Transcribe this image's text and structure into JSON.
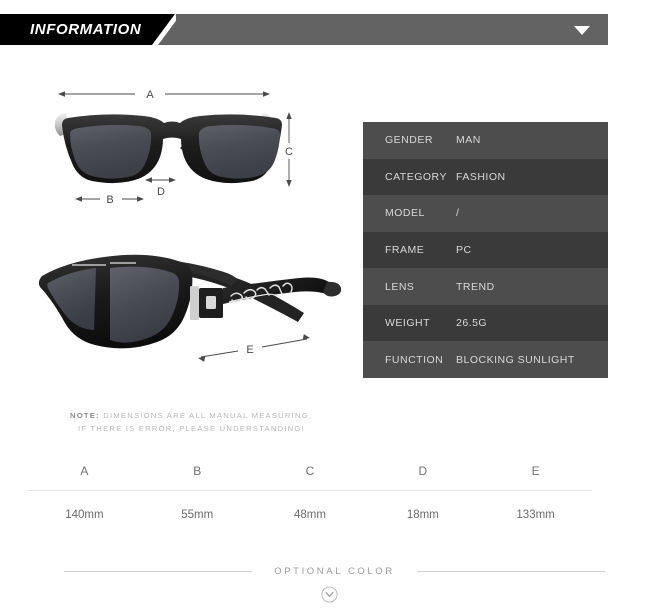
{
  "header": {
    "tab_label": "INFORMATION",
    "caret_icon": "chevron-down-icon",
    "bar_color": "#636363",
    "tab_color": "#000000"
  },
  "diagram": {
    "front_view_alt": "sunglasses-front-view",
    "angle_view_alt": "sunglasses-angled-view",
    "markers": {
      "a": "A",
      "b": "B",
      "c": "C",
      "d": "D",
      "e": "E"
    }
  },
  "note": {
    "label": "NOTE:",
    "line1": " DIMENSIONS ARE ALL MANUAL MEASURING,",
    "line2": "IF THERE IS ERROR, PLEASE UNDERSTANDING!"
  },
  "spec_table": {
    "rows": [
      {
        "label": "GENDER",
        "value": "MAN"
      },
      {
        "label": "CATEGORY",
        "value": "FASHION"
      },
      {
        "label": "MODEL",
        "value": "/"
      },
      {
        "label": "FRAME",
        "value": "PC"
      },
      {
        "label": "LENS",
        "value": "TREND"
      },
      {
        "label": "WEIGHT",
        "value": "26.5G"
      },
      {
        "label": "FUNCTION",
        "value": "BLOCKING SUNLIGHT"
      }
    ],
    "row_color_odd": "#4d4d4d",
    "row_color_even": "#3a3a3a",
    "text_color": "#d8d8d8"
  },
  "dimension_table": {
    "headers": [
      "A",
      "B",
      "C",
      "D",
      "E"
    ],
    "values": [
      "140mm",
      "55mm",
      "48mm",
      "18mm",
      "133mm"
    ]
  },
  "optional_color": {
    "label": "OPTIONAL COLOR",
    "toggle_icon": "chevron-down-circle-icon"
  }
}
